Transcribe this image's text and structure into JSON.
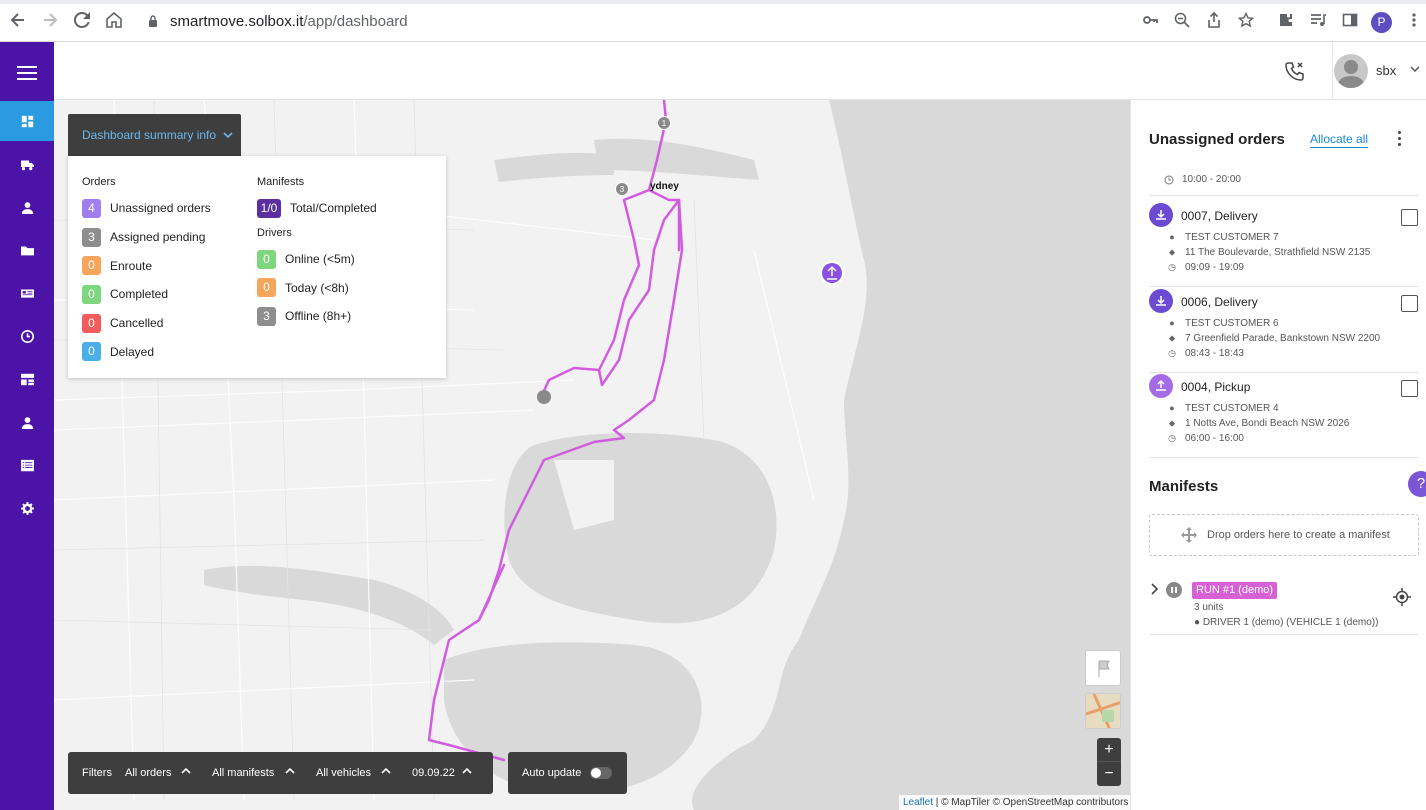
{
  "browser": {
    "url_host": "smartmove.solbox.it",
    "url_path": "/app/dashboard",
    "profile_initial": "P"
  },
  "header": {
    "username": "sbx"
  },
  "summary": {
    "toggle_label": "Dashboard summary info",
    "orders_heading": "Orders",
    "manifests_heading": "Manifests",
    "drivers_heading": "Drivers",
    "orders": [
      {
        "count": "4",
        "label": "Unassigned orders",
        "color": "#a07ef0"
      },
      {
        "count": "3",
        "label": "Assigned pending",
        "color": "#8e8e8e"
      },
      {
        "count": "0",
        "label": "Enroute",
        "color": "#f6a55a"
      },
      {
        "count": "0",
        "label": "Completed",
        "color": "#7ed67e"
      },
      {
        "count": "0",
        "label": "Cancelled",
        "color": "#f25c5c"
      },
      {
        "count": "0",
        "label": "Delayed",
        "color": "#4aaee8"
      }
    ],
    "manifests": [
      {
        "count": "1/0",
        "label": "Total/Completed",
        "color": "#5b2fa0"
      }
    ],
    "drivers": [
      {
        "count": "0",
        "label": "Online (<5m)",
        "color": "#7ed67e"
      },
      {
        "count": "0",
        "label": "Today (<8h)",
        "color": "#f6a55a"
      },
      {
        "count": "3",
        "label": "Offline (8h+)",
        "color": "#8e8e8e"
      }
    ]
  },
  "filters": {
    "label": "Filters",
    "orders": "All orders",
    "manifests": "All manifests",
    "vehicles": "All vehicles",
    "date": "09.09.22",
    "auto_update": "Auto update"
  },
  "map": {
    "city_label": "ydney",
    "marker_1": "1",
    "marker_3": "3",
    "zoom_in": "+",
    "zoom_out": "−",
    "attribution_leaflet": "Leaflet",
    "attribution_rest": " | © MapTiler © OpenStreetMap contributors",
    "route_color": "#d25ce0"
  },
  "panel": {
    "unassigned_title": "Unassigned orders",
    "allocate_all": "Allocate all",
    "top_time": "10:00 - 20:00",
    "orders": [
      {
        "title": "0007, Delivery",
        "customer": "TEST CUSTOMER 7",
        "address": "11 The Boulevarde, Strathfield NSW 2135",
        "time": "09:09 - 19:09",
        "kind": "delivery"
      },
      {
        "title": "0006, Delivery",
        "customer": "TEST CUSTOMER 6",
        "address": "7 Greenfield Parade, Bankstown NSW 2200",
        "time": "08:43 - 18:43",
        "kind": "delivery"
      },
      {
        "title": "0004, Pickup",
        "customer": "TEST CUSTOMER 4",
        "address": "1 Notts Ave, Bondi Beach NSW 2026",
        "time": "06:00 - 16:00",
        "kind": "pickup"
      }
    ],
    "manifests_title": "Manifests",
    "help": "?",
    "drop_text": "Drop orders here to create a manifest",
    "run": {
      "tag": "RUN #1 (demo)",
      "units": "3 units",
      "driver": "DRIVER 1 (demo) (VEHICLE 1 (demo))"
    }
  }
}
